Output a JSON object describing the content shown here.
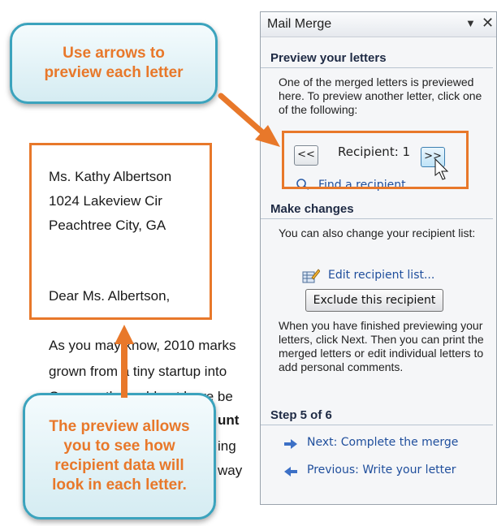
{
  "callouts": {
    "top": [
      "Use arrows to",
      "preview each letter"
    ],
    "bottom": [
      "The preview allows",
      "you to see how",
      "recipient data will",
      "look in each letter."
    ]
  },
  "letter": {
    "name": "Ms. Kathy Albertson",
    "street": "1024  Lakeview Cir",
    "city": "Peachtree City, GA",
    "salutation": "Dear Ms. Albertson,",
    "body_lines": [
      "As you may know, 2010 marks",
      "grown from a tiny startup into",
      "Our growth would not have be",
      "unt",
      "ing",
      "way"
    ]
  },
  "pane": {
    "title": "Mail Merge",
    "dropdown_glyph": "▼",
    "close_glyph": "✕",
    "preview": {
      "heading": "Preview your letters",
      "description": "One of the merged letters is previewed here. To preview another letter, click one of the following:",
      "prev_button": "<<",
      "next_button": ">>",
      "recipient_label": "Recipient: 1",
      "find_link": "Find a recipient..."
    },
    "changes": {
      "heading": "Make changes",
      "description": "You can also change your recipient list:",
      "edit_link": "Edit recipient list...",
      "exclude_button": "Exclude this recipient",
      "finish_text": "When you have finished previewing your letters, click Next. Then you can print the merged letters or edit individual letters to add personal comments."
    },
    "step": {
      "heading": "Step 5 of 6",
      "next_link": "Next: Complete the merge",
      "prev_link": "Previous: Write your letter"
    }
  },
  "colors": {
    "accent_orange": "#e8782a",
    "callout_border": "#3ba3bd",
    "link_blue": "#1f4e9c"
  }
}
